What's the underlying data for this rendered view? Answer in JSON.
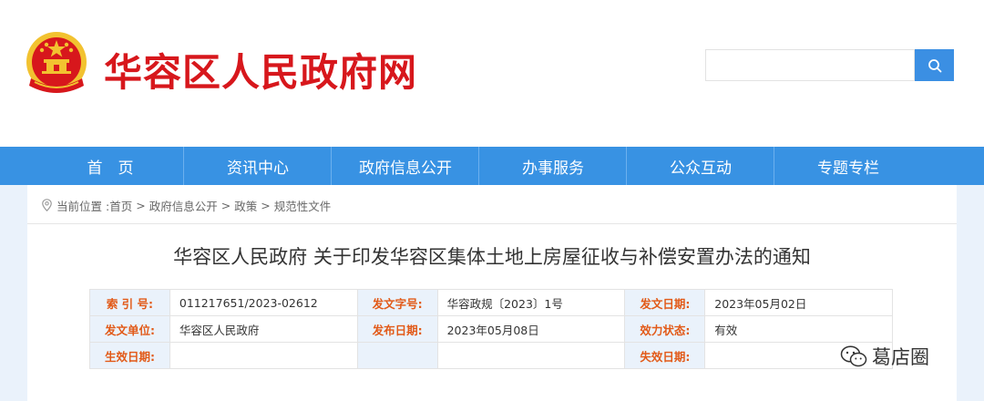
{
  "header": {
    "site_title": "华容区人民政府网",
    "search": {
      "placeholder": "",
      "value": ""
    }
  },
  "nav": {
    "items": [
      {
        "label": "首　页"
      },
      {
        "label": "资讯中心"
      },
      {
        "label": "政府信息公开"
      },
      {
        "label": "办事服务"
      },
      {
        "label": "公众互动"
      },
      {
        "label": "专题专栏"
      }
    ]
  },
  "breadcrumb": {
    "prefix": "当前位置 :",
    "items": [
      "首页",
      "政府信息公开",
      "政策",
      "规范性文件"
    ],
    "separator": ">"
  },
  "article": {
    "title": "华容区人民政府 关于印发华容区集体土地上房屋征收与补偿安置办法的通知",
    "info": {
      "index_label": "索 引 号:",
      "index_value": "011217651/2023-02612",
      "doc_no_label": "发文字号:",
      "doc_no_value": "华容政规〔2023〕1号",
      "issue_date_label": "发文日期:",
      "issue_date_value": "2023年05月02日",
      "issuer_label": "发文单位:",
      "issuer_value": "华容区人民政府",
      "publish_date_label": "发布日期:",
      "publish_date_value": "2023年05月08日",
      "status_label": "效力状态:",
      "status_value": "有效",
      "effective_date_label": "生效日期:",
      "effective_date_value": "",
      "expiry_date_label": "失效日期:",
      "expiry_date_value": ""
    }
  },
  "watermark": {
    "text": "葛店圈"
  },
  "colors": {
    "brand_red": "#d7171c",
    "nav_blue": "#3892e3",
    "label_orange": "#e25a18",
    "page_bg": "#eaf2fb"
  }
}
